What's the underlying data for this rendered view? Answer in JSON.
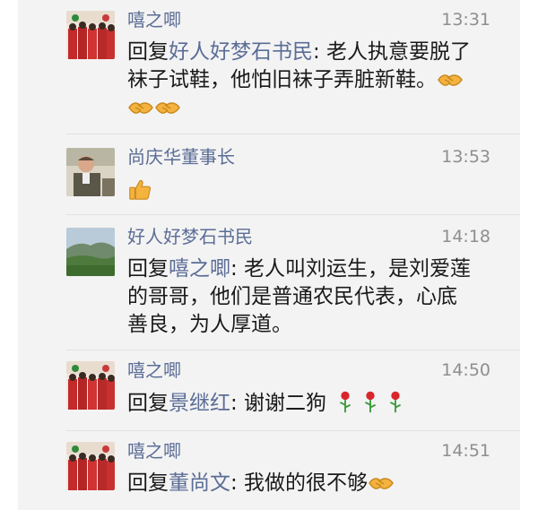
{
  "reply_prefix": "回复",
  "comments": [
    {
      "author": "嘻之唧",
      "time": "13:31",
      "mention": "好人好梦石书民",
      "text_line1": ": 老人执意要脱了",
      "text_line2": "袜子试鞋，他怕旧袜子弄脏新鞋。",
      "emojis": [
        "handshake",
        "handshake",
        "handshake"
      ]
    },
    {
      "author": "尚庆华董事长",
      "time": "13:53",
      "emojis": [
        "thumbs-up"
      ]
    },
    {
      "author": "好人好梦石书民",
      "time": "14:18",
      "mention": "嘻之唧",
      "text_line1": ": 老人叫刘运生，是刘爱莲",
      "text_line2": "的哥哥，他们是普通农民代表，心底",
      "text_line3": "善良，为人厚道。"
    },
    {
      "author": "嘻之唧",
      "time": "14:50",
      "mention": "景继红",
      "text_line1": ": 谢谢二狗",
      "emojis": [
        "rose",
        "rose",
        "rose"
      ]
    },
    {
      "author": "嘻之唧",
      "time": "14:51",
      "mention": "董尚文",
      "text_line1": ": 我做的很不够",
      "emojis": [
        "handshake"
      ]
    }
  ]
}
